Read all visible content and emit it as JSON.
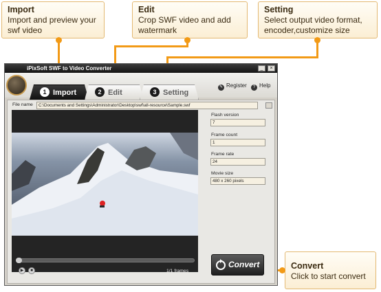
{
  "callouts": {
    "import": {
      "title": "Import",
      "text": "Import and preview your swf video"
    },
    "edit": {
      "title": "Edit",
      "text": "Crop SWF video and add watermark"
    },
    "setting": {
      "title": "Setting",
      "text": "Select output video format, encoder,customize size"
    },
    "convert": {
      "title": "Convert",
      "text": "Click to start convert"
    }
  },
  "window": {
    "title": "iPixSoft SWF to Video Converter",
    "minimize": "_",
    "close": "×"
  },
  "tabs": [
    {
      "num": "1",
      "label": "Import"
    },
    {
      "num": "2",
      "label": "Edit"
    },
    {
      "num": "3",
      "label": "Setting"
    }
  ],
  "header": {
    "register": "Register",
    "help": "Help"
  },
  "file": {
    "label": "File name",
    "path": "C:\\Documents and Settings\\Administrator\\Desktop\\swf\\all-resource\\Sample.swf"
  },
  "info": {
    "flash_version": {
      "label": "Flash version",
      "value": "7"
    },
    "frame_count": {
      "label": "Frame count",
      "value": "1"
    },
    "frame_rate": {
      "label": "Frame rate",
      "value": "24"
    },
    "movie_size": {
      "label": "Movie size",
      "value": "480 x 260 pixels"
    }
  },
  "player": {
    "frames": "1/1 frames"
  },
  "convert_button": "Convert",
  "colors": {
    "accent": "#f29a16",
    "callout_border": "#e3b871"
  }
}
